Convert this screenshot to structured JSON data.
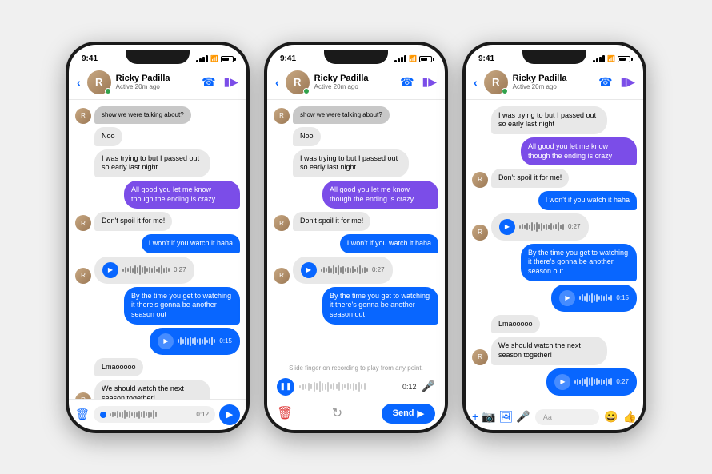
{
  "phones": [
    {
      "id": "phone1",
      "time": "9:41",
      "contact": "Ricky Padilla",
      "status": "Active 20m ago",
      "messages": [
        {
          "type": "received-top",
          "text": "show we were talking about?"
        },
        {
          "type": "received",
          "text": "Noo"
        },
        {
          "type": "received",
          "text": "I was trying to but I passed out so early last night"
        },
        {
          "type": "sent-purple",
          "text": "All good you let me know though the ending is crazy"
        },
        {
          "type": "received",
          "text": "Don't spoil it for me!"
        },
        {
          "type": "sent-blue",
          "text": "I won't if you watch it haha"
        },
        {
          "type": "voice-received",
          "duration": "0:27"
        },
        {
          "type": "voice-sent-blue-text",
          "text": "By the time you get to watching it there's gonna be another season out"
        },
        {
          "type": "voice-sent-blue",
          "duration": "0:15"
        },
        {
          "type": "received",
          "text": "Lmaooooo"
        },
        {
          "type": "received",
          "text": "We should watch the next season together!"
        }
      ],
      "input": {
        "recording": true,
        "duration": "0:12"
      }
    },
    {
      "id": "phone2",
      "time": "9:41",
      "contact": "Ricky Padilla",
      "status": "Active 20m ago",
      "messages": [
        {
          "type": "received-top",
          "text": "show we were talking about?"
        },
        {
          "type": "received",
          "text": "Noo"
        },
        {
          "type": "received",
          "text": "I was trying to but I passed out so early last night"
        },
        {
          "type": "sent-purple",
          "text": "All good you let me know though the ending is crazy"
        },
        {
          "type": "received",
          "text": "Don't spoil it for me!"
        },
        {
          "type": "sent-blue",
          "text": "I won't if you watch it haha"
        },
        {
          "type": "voice-received",
          "duration": "0:27"
        },
        {
          "type": "voice-sent-blue-text",
          "text": "By the time you get to watching it there's gonna be another season out"
        }
      ],
      "overlay": true,
      "overlay_hint": "Slide finger on recording to play from any point.",
      "overlay_duration": "0:12"
    },
    {
      "id": "phone3",
      "time": "9:41",
      "contact": "Ricky Padilla",
      "status": "Active 20m ago",
      "messages": [
        {
          "type": "received",
          "text": "I was trying to but I passed out so early last night"
        },
        {
          "type": "sent-purple",
          "text": "All good you let me know though the ending is crazy"
        },
        {
          "type": "received",
          "text": "Don't spoil it for me!"
        },
        {
          "type": "sent-blue",
          "text": "I won't if you watch it haha"
        },
        {
          "type": "voice-received",
          "duration": "0:27"
        },
        {
          "type": "voice-sent-blue-text",
          "text": "By the time you get to watching it there's gonna be another season out"
        },
        {
          "type": "voice-sent-blue",
          "duration": "0:15"
        },
        {
          "type": "received",
          "text": "Lmaooooo"
        },
        {
          "type": "received",
          "text": "We should watch the next season together!"
        },
        {
          "type": "voice-sent-blue",
          "duration": "0:27"
        }
      ],
      "input": {
        "type": "normal"
      }
    }
  ],
  "labels": {
    "send": "Send",
    "aa": "Aa"
  }
}
